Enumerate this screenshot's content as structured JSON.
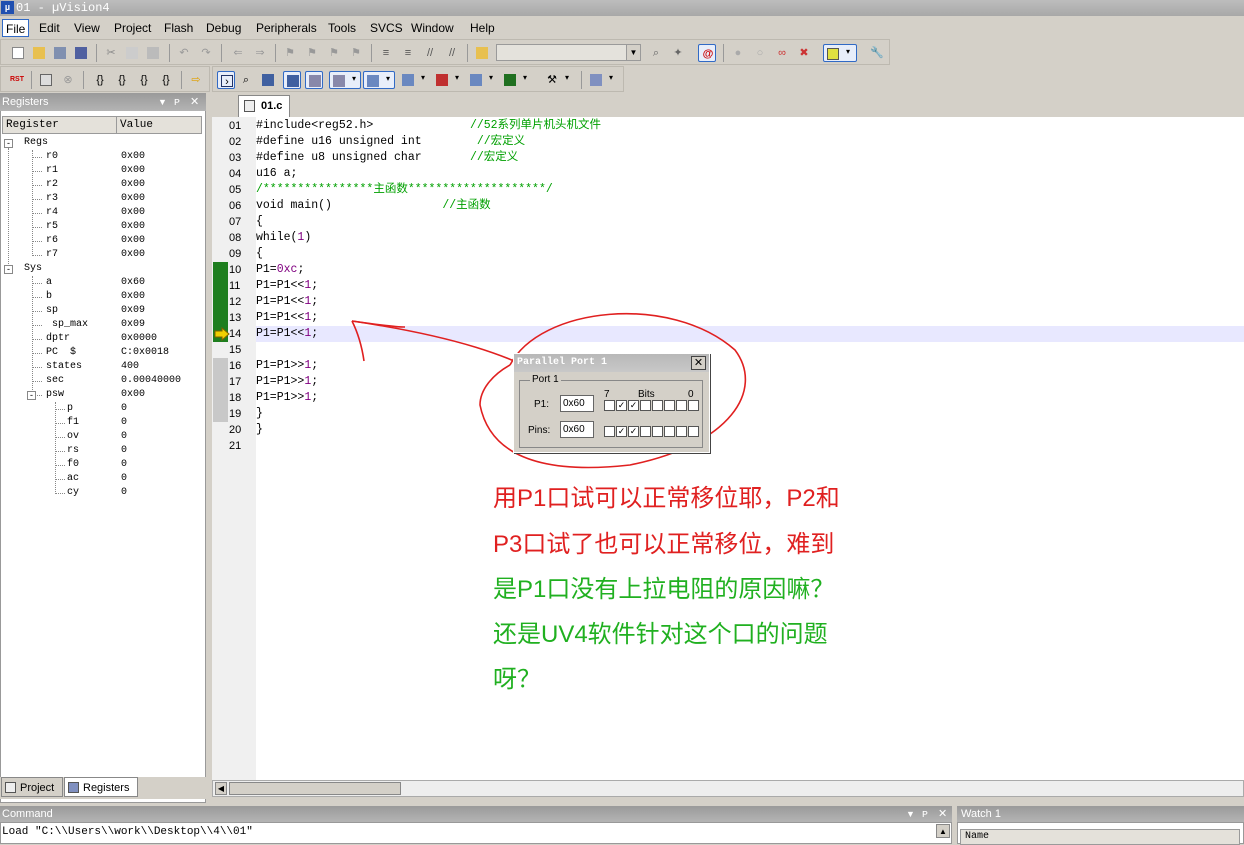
{
  "window": {
    "title": "01  - µVision4",
    "icon": "uv4-app-icon"
  },
  "menu": [
    "File",
    "Edit",
    "View",
    "Project",
    "Flash",
    "Debug",
    "Peripherals",
    "Tools",
    "SVCS",
    "Window",
    "Help"
  ],
  "toolbar": {
    "target_combo_value": ""
  },
  "registers_panel": {
    "title": "Registers",
    "columns": [
      "Register",
      "Value"
    ],
    "regs_group": "Regs",
    "regs": [
      {
        "name": "r0",
        "value": "0x00"
      },
      {
        "name": "r1",
        "value": "0x00"
      },
      {
        "name": "r2",
        "value": "0x00"
      },
      {
        "name": "r3",
        "value": "0x00"
      },
      {
        "name": "r4",
        "value": "0x00"
      },
      {
        "name": "r5",
        "value": "0x00"
      },
      {
        "name": "r6",
        "value": "0x00"
      },
      {
        "name": "r7",
        "value": "0x00"
      }
    ],
    "sys_group": "Sys",
    "sys": [
      {
        "name": "a",
        "value": "0x60"
      },
      {
        "name": "b",
        "value": "0x00"
      },
      {
        "name": "sp",
        "value": "0x09"
      },
      {
        "name": "sp_max",
        "value": "0x09"
      },
      {
        "name": "dptr",
        "value": "0x0000"
      },
      {
        "name": "PC  $",
        "value": "C:0x0018"
      },
      {
        "name": "states",
        "value": "400"
      },
      {
        "name": "sec",
        "value": "0.00040000"
      },
      {
        "name": "psw",
        "value": "0x00"
      }
    ],
    "psw_bits": [
      {
        "name": "p",
        "value": "0"
      },
      {
        "name": "f1",
        "value": "0"
      },
      {
        "name": "ov",
        "value": "0"
      },
      {
        "name": "rs",
        "value": "0"
      },
      {
        "name": "f0",
        "value": "0"
      },
      {
        "name": "ac",
        "value": "0"
      },
      {
        "name": "cy",
        "value": "0"
      }
    ],
    "tabs": [
      "Project",
      "Registers"
    ]
  },
  "editor": {
    "tab": "01.c",
    "lines": [
      {
        "n": "01",
        "code": "#include<reg52.h>",
        "comment": "//52系列单片机头机文件",
        "cpad": "              "
      },
      {
        "n": "02",
        "code": "#define u16 unsigned int",
        "comment": "//宏定义",
        "cpad": "        "
      },
      {
        "n": "03",
        "code": "#define u8 unsigned char",
        "comment": "//宏定义",
        "cpad": "       "
      },
      {
        "n": "04",
        "code": "u16 a;",
        "comment": "",
        "cpad": ""
      },
      {
        "n": "05",
        "code": "",
        "comment": "/****************主函数********************/",
        "cpad": ""
      },
      {
        "n": "06",
        "code": "void main()",
        "comment": "//主函数",
        "cpad": "                "
      },
      {
        "n": "07",
        "code": "{",
        "comment": "",
        "cpad": ""
      },
      {
        "n": "08",
        "code": "while(1)",
        "comment": "",
        "cpad": ""
      },
      {
        "n": "09",
        "code": "{",
        "comment": "",
        "cpad": ""
      },
      {
        "n": "10",
        "code": "P1=0xc;",
        "comment": "",
        "cpad": ""
      },
      {
        "n": "11",
        "code": "P1=P1<<1;",
        "comment": "",
        "cpad": ""
      },
      {
        "n": "12",
        "code": "P1=P1<<1;",
        "comment": "",
        "cpad": ""
      },
      {
        "n": "13",
        "code": "P1=P1<<1;",
        "comment": "",
        "cpad": ""
      },
      {
        "n": "14",
        "code": "P1=P1<<1;",
        "comment": "",
        "cpad": ""
      },
      {
        "n": "15",
        "code": "",
        "comment": "",
        "cpad": ""
      },
      {
        "n": "16",
        "code": "P1=P1>>1;",
        "comment": "",
        "cpad": ""
      },
      {
        "n": "17",
        "code": "P1=P1>>1;",
        "comment": "",
        "cpad": ""
      },
      {
        "n": "18",
        "code": "P1=P1>>1;",
        "comment": "",
        "cpad": ""
      },
      {
        "n": "19",
        "code": "}",
        "comment": "",
        "cpad": ""
      },
      {
        "n": "20",
        "code": "}",
        "comment": "",
        "cpad": ""
      },
      {
        "n": "21",
        "code": "",
        "comment": "",
        "cpad": ""
      }
    ],
    "current_line": "14"
  },
  "parallel_port": {
    "title": "Parallel Port 1",
    "group": "Port 1",
    "bits_label": "Bits",
    "bit_high": "7",
    "bit_low": "0",
    "p1_label": "P1:",
    "p1_value": "0x60",
    "pins_label": "Pins:",
    "pins_value": "0x60",
    "p1_bits": [
      0,
      1,
      1,
      0,
      0,
      0,
      0,
      0
    ],
    "pins_bits": [
      0,
      1,
      1,
      0,
      0,
      0,
      0,
      0
    ]
  },
  "annotation": {
    "red_lines": [
      "用P1口试可以正常移位耶，P2和",
      "P3口试了也可以正常移位，难到"
    ],
    "green_lines": [
      "是P1口没有上拉电阻的原因嘛？",
      "还是UV4软件针对这个口的问题",
      "呀？"
    ],
    "red_color": "#e02020",
    "green_color": "#20b020"
  },
  "command": {
    "title": "Command",
    "text": "Load \"C:\\\\Users\\\\work\\\\Desktop\\\\4\\\\01\""
  },
  "watch": {
    "title": "Watch 1",
    "col_name": "Name"
  }
}
